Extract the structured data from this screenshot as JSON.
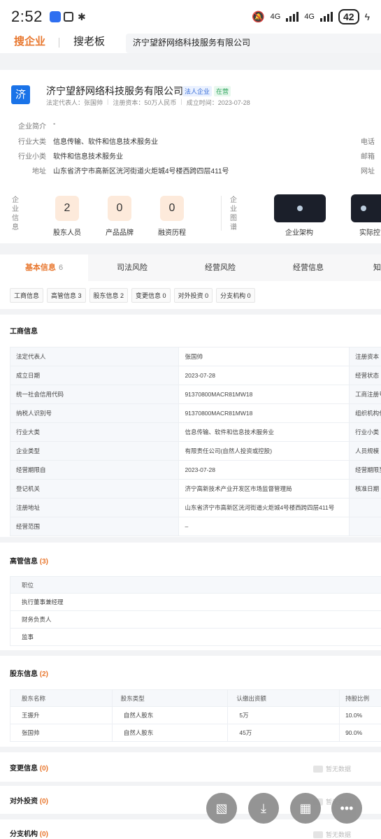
{
  "status_bar": {
    "time": "2:52",
    "network1": "4G",
    "network2": "4G",
    "battery": "42"
  },
  "header": {
    "tab1": "搜企业",
    "tab2": "搜老板",
    "search_value": "济宁望舒网络科技服务有限公司"
  },
  "company": {
    "logo_char": "济",
    "name": "济宁望舒网络科技服务有限公司",
    "tag_legal": "法人企业",
    "tag_status": "在营",
    "meta_rep": "法定代表人：张国帅",
    "meta_capital": "注册资本：50万人民币",
    "meta_date": "成立时间：2023-07-28",
    "rows": [
      {
        "label": "企业简介",
        "value": "-"
      },
      {
        "label": "行业大类",
        "value": "信息传输、软件和信息技术服务业"
      },
      {
        "label": "行业小类",
        "value": "软件和信息技术服务业"
      },
      {
        "label": "地址",
        "value": "山东省济宁市高新区洸河街道火炬城4号楼西跨四层411号"
      }
    ],
    "right_labels": [
      "电话",
      "邮箱",
      "网址"
    ],
    "side_info": "企业信息",
    "side_graph": "企业图谱",
    "stats": [
      {
        "num": "2",
        "label": "股东人员"
      },
      {
        "num": "0",
        "label": "产品品牌"
      },
      {
        "num": "0",
        "label": "融资历程"
      }
    ],
    "graph1": "企业架构",
    "graph2": "实际控"
  },
  "section_tabs": [
    {
      "label": "基本信息",
      "count": "6"
    },
    {
      "label": "司法风险",
      "count": ""
    },
    {
      "label": "经营风险",
      "count": ""
    },
    {
      "label": "经营信息",
      "count": ""
    },
    {
      "label": "知",
      "count": ""
    }
  ],
  "chips": [
    "工商信息",
    "高管信息 3",
    "股东信息 2",
    "变更信息 0",
    "对外投资 0",
    "分支机构 0"
  ],
  "business": {
    "title": "工商信息",
    "rows": [
      [
        "法定代表人",
        "张国帅",
        "注册资本"
      ],
      [
        "成立日期",
        "2023-07-28",
        "经营状态"
      ],
      [
        "统一社会信用代码",
        "91370800MACR81MW18",
        "工商注册号"
      ],
      [
        "纳税人识别号",
        "91370800MACR81MW18",
        "组织机构代"
      ],
      [
        "行业大类",
        "信息传输、软件和信息技术服务业",
        "行业小类"
      ],
      [
        "企业类型",
        "有限责任公司(自然人投资或控股)",
        "人员规模"
      ],
      [
        "经营期限自",
        "2023-07-28",
        "经营期限至"
      ],
      [
        "登记机关",
        "济宁高新技术产业开发区市场监督管理局",
        "核准日期"
      ],
      [
        "注册地址",
        "山东省济宁市高新区洸河街道火炬城4号楼西跨四层411号",
        ""
      ],
      [
        "经营范围",
        "–",
        ""
      ]
    ]
  },
  "executives": {
    "title": "高管信息",
    "count": "(3)",
    "header": "职位",
    "rows": [
      "执行董事兼经理",
      "财务负责人",
      "监事"
    ]
  },
  "shareholders": {
    "title": "股东信息",
    "count": "(2)",
    "headers": [
      "股东名称",
      "股东类型",
      "认缴出资额",
      "持股比例"
    ],
    "rows": [
      [
        "王振升",
        "自然人股东",
        "5万",
        "10.0%"
      ],
      [
        "张国帅",
        "自然人股东",
        "45万",
        "90.0%"
      ]
    ]
  },
  "changes": {
    "title": "变更信息",
    "count": "(0)",
    "nodata": "暂无数据"
  },
  "investments": {
    "title": "对外投资",
    "count": "(0)",
    "nodata": "暂无数据"
  },
  "branches": {
    "title": "分支机构",
    "count": "(0)",
    "nodata": "暂无数据"
  }
}
